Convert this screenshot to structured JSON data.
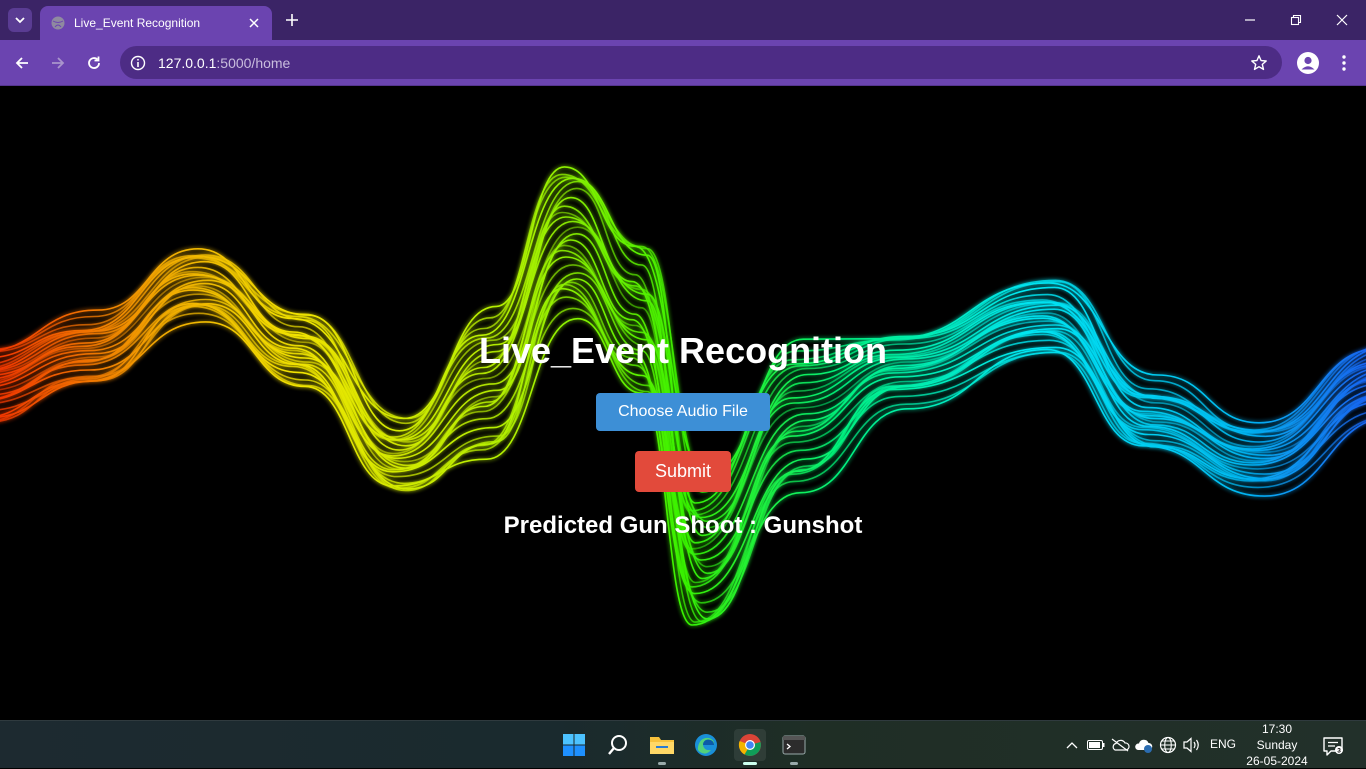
{
  "browser": {
    "tab_title": "Live_Event Recognition",
    "url_host": "127.0.0.1",
    "url_path": ":5000/home"
  },
  "page": {
    "heading": "Live_Event Recognition",
    "choose_button": "Choose Audio File",
    "submit_button": "Submit",
    "result_text": "Predicted Gun Shoot : Gunshot"
  },
  "taskbar": {
    "language": "ENG",
    "time": "17:30",
    "day": "Sunday",
    "date": "26-05-2024"
  },
  "colors": {
    "chrome_tabbar": "#3b2466",
    "chrome_toolbar": "#6b44b0",
    "choose_button": "#3d8fd6",
    "submit_button": "#e24a3b"
  }
}
